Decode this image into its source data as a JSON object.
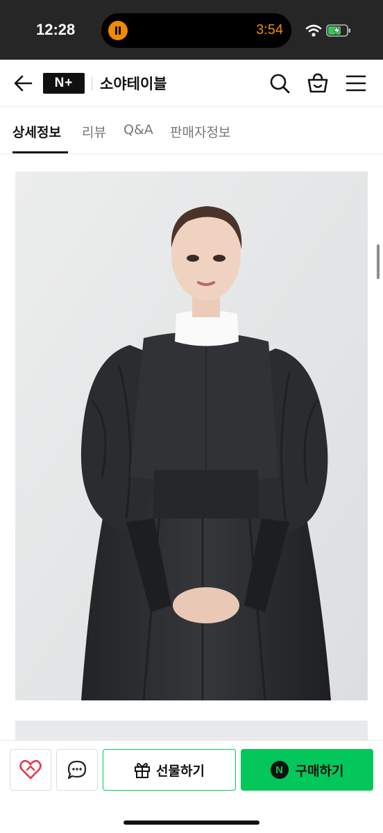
{
  "status_bar": {
    "time": "12:28",
    "activity_time": "3:54"
  },
  "header": {
    "brand_logo": "N+",
    "store_name": "소야테이블"
  },
  "tabs": [
    {
      "label": "상세정보",
      "active": true
    },
    {
      "label": "리뷰",
      "active": false
    },
    {
      "label": "Q&A",
      "active": false
    },
    {
      "label": "판매자정보",
      "active": false
    }
  ],
  "product": {
    "image": "product-photo-black-puff-sleeve-dress"
  },
  "actions": {
    "gift_label": "선물하기",
    "buy_label": "구매하기",
    "pay_badge": "N"
  },
  "colors": {
    "accent_green": "#03c75a",
    "wish_red": "#e8334a",
    "status_orange": "#f08a00"
  }
}
